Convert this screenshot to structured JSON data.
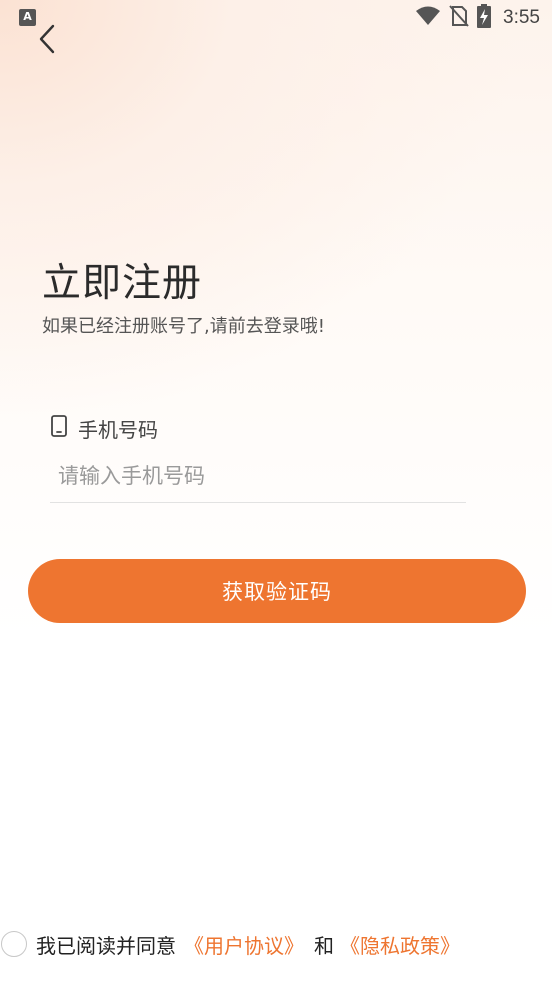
{
  "status_bar": {
    "app_badge": "A",
    "time": "3:55",
    "icons": [
      "wifi-icon",
      "no-sim-icon",
      "battery-charging-icon"
    ]
  },
  "header": {
    "back_icon": "chevron-left-icon"
  },
  "register": {
    "title": "立即注册",
    "subtitle": "如果已经注册账号了,请前去登录哦!"
  },
  "phone_field": {
    "icon": "phone-icon",
    "label": "手机号码",
    "value": "",
    "placeholder": "请输入手机号码"
  },
  "submit_button": {
    "label": "获取验证码"
  },
  "agreement": {
    "checked": false,
    "prefix": "我已阅读并同意",
    "user_agreement_link": "《用户协议》",
    "and": "和",
    "privacy_policy_link": "《隐私政策》"
  },
  "colors": {
    "accent": "#ee7530",
    "title_text": "#2b2b2b",
    "placeholder": "#9a9a9a"
  }
}
